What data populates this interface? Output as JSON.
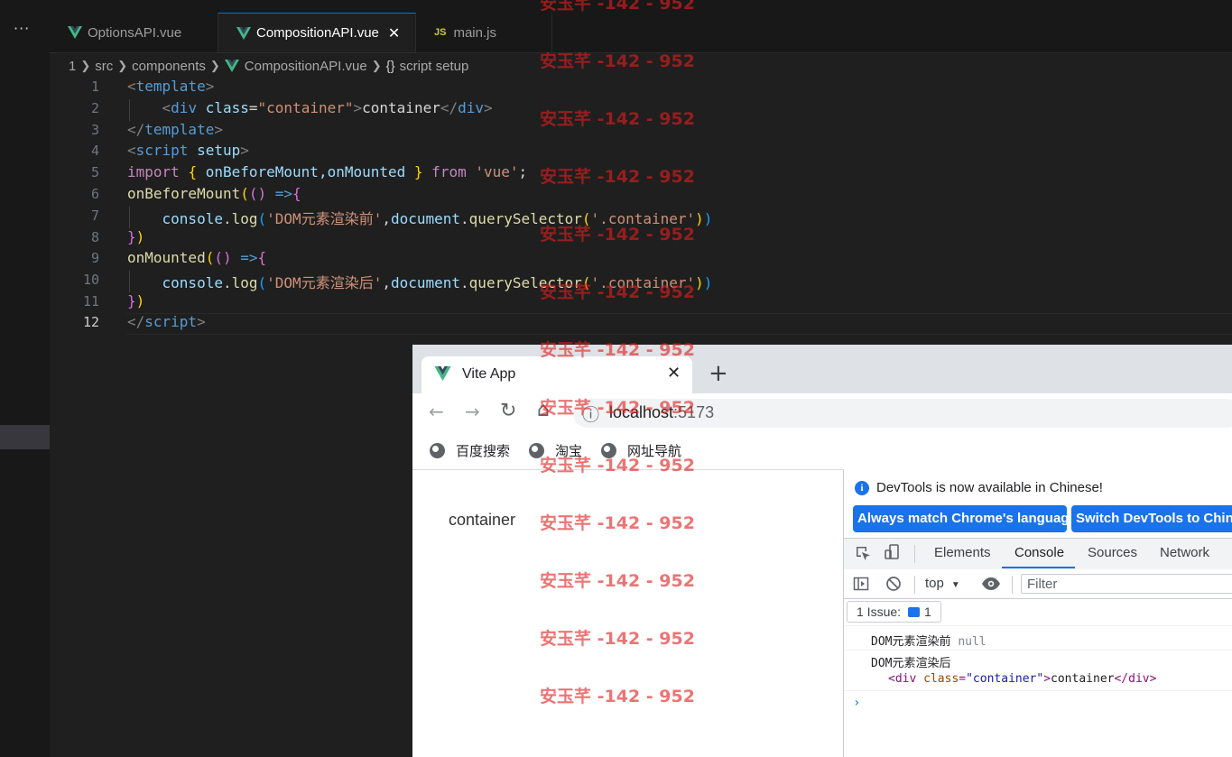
{
  "editor": {
    "tabs": [
      {
        "label": "OptionsAPI.vue",
        "icon": "vue-icon"
      },
      {
        "label": "CompositionAPI.vue",
        "icon": "vue-icon",
        "active": true
      },
      {
        "label": "main.js",
        "icon": "js-icon",
        "icon_text": "JS"
      }
    ],
    "tab_close": "✕",
    "overflow": "···",
    "breadcrumb": {
      "num": "1",
      "src": "src",
      "components": "components",
      "file": "CompositionAPI.vue",
      "symbol_icon": "{}",
      "symbol": "script setup"
    },
    "line_numbers": [
      "1",
      "2",
      "3",
      "4",
      "5",
      "6",
      "7",
      "8",
      "9",
      "10",
      "11",
      "12"
    ],
    "current_line": "12",
    "code": {
      "l1": {
        "lt": "<",
        "tag": "template",
        "gt": ">"
      },
      "l2": {
        "indent": "    ",
        "lt": "<",
        "tag": "div",
        "sp": " ",
        "attr": "class",
        "eq": "=",
        "val": "\"container\"",
        "gt": ">",
        "text": "container",
        "lt2": "</",
        "tag2": "div",
        "gt2": ">"
      },
      "l3": {
        "lt": "</",
        "tag": "template",
        "gt": ">"
      },
      "l4": {
        "lt": "<",
        "tag": "script",
        "sp": " ",
        "attr": "setup",
        "gt": ">"
      },
      "l5": {
        "kw": "import",
        "sp": " ",
        "ob": "{",
        "names": " onBeforeMount,onMounted ",
        "cb": "}",
        "from": " from ",
        "str": "'vue'",
        "semi": ";"
      },
      "l6": {
        "fn": "onBeforeMount",
        "p1": "(",
        "p2": "()",
        "sp": " ",
        "arrow": "=>",
        "b": "{"
      },
      "l7": {
        "indent": "    ",
        "obj": "console",
        "dot": ".",
        "fn": "log",
        "p1": "(",
        "str": "'DOM元素渲染前'",
        "comma": ",",
        "doc": "document",
        "dot2": ".",
        "qs": "querySelector",
        "p2": "(",
        "sel": "'.container'",
        "p2c": ")",
        "p1c": ")"
      },
      "l8": {
        "b": "}",
        "p": ")"
      },
      "l9": {
        "fn": "onMounted",
        "p1": "(",
        "p2": "()",
        "sp": " ",
        "arrow": "=>",
        "b": "{"
      },
      "l10": {
        "indent": "    ",
        "obj": "console",
        "dot": ".",
        "fn": "log",
        "p1": "(",
        "str": "'DOM元素渲染后'",
        "comma": ",",
        "doc": "document",
        "dot2": ".",
        "qs": "querySelector",
        "p2": "(",
        "sel": "'.container'",
        "p2c": ")",
        "p1c": ")"
      },
      "l11": {
        "b": "}",
        "p": ")"
      },
      "l12": {
        "lt": "</",
        "tag": "script",
        "gt": ">"
      }
    }
  },
  "browser": {
    "tab_title": "Vite App",
    "tab_close": "✕",
    "new_tab": "+",
    "nav": {
      "back": "←",
      "forward": "→",
      "reload": "↻",
      "home": "⌂",
      "info": "ⓘ"
    },
    "url_host": "localhost",
    "url_port": ":5173",
    "bookmarks": [
      "百度搜索",
      "淘宝",
      "网址导航"
    ],
    "page_text": "container"
  },
  "devtools": {
    "info_icon": "i",
    "info_text": "DevTools is now available in Chinese!",
    "btn_match": "Always match Chrome's language",
    "btn_switch": "Switch DevTools to Chinese",
    "tabs": [
      "Elements",
      "Console",
      "Sources",
      "Network"
    ],
    "active_tab": "Console",
    "context": "top",
    "context_arrow": "▼",
    "filter_placeholder": "Filter",
    "issue_label": "1 Issue:",
    "issue_count": "1",
    "messages": {
      "m1_text": "DOM元素渲染前",
      "m1_value": "null",
      "m2_text": "DOM元素渲染后",
      "m2_lt": "<",
      "m2_tag": "div",
      "m2_attr": " class",
      "m2_eq": "=",
      "m2_val": "\"container\"",
      "m2_gt": ">",
      "m2_text2": "container",
      "m2_close": "</div>"
    },
    "prompt": "›"
  },
  "watermark": {
    "text": "安玉芊 -142 - 952",
    "count": 13
  },
  "colors": {
    "editor_bg": "#1f1f1f",
    "accent": "#0078d4",
    "vue_green": "#41b883",
    "chrome_blue": "#1a73e8",
    "watermark": "#e11e1e"
  }
}
